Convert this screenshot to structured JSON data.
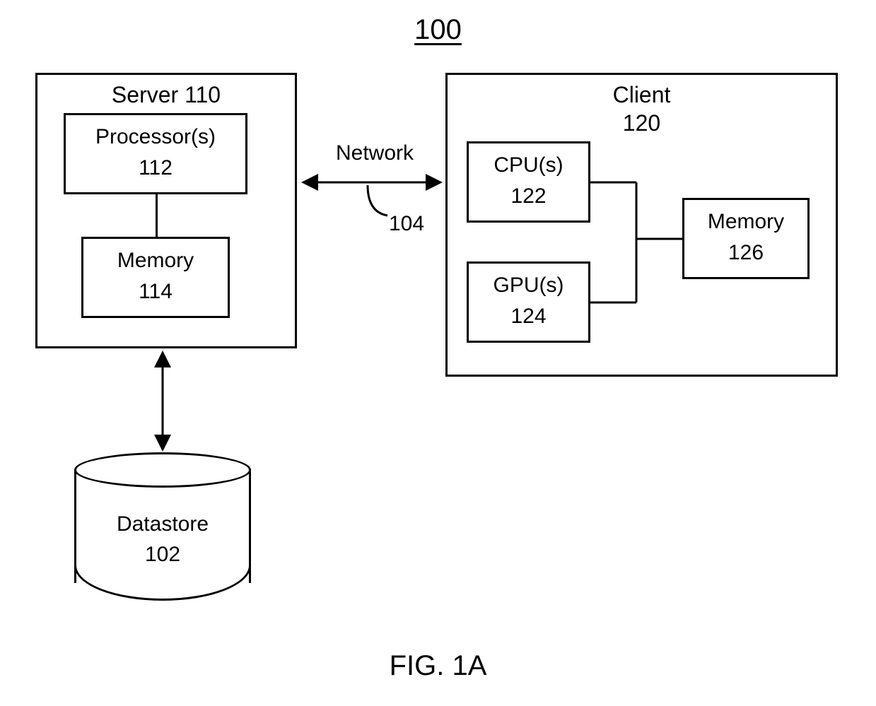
{
  "figure": {
    "number": "100",
    "caption": "FIG. 1A"
  },
  "server": {
    "title": "Server 110",
    "processor": {
      "line1": "Processor(s)",
      "line2": "112"
    },
    "memory": {
      "line1": "Memory",
      "line2": "114"
    }
  },
  "client": {
    "title_line1": "Client",
    "title_line2": "120",
    "cpu": {
      "line1": "CPU(s)",
      "line2": "122"
    },
    "gpu": {
      "line1": "GPU(s)",
      "line2": "124"
    },
    "memory": {
      "line1": "Memory",
      "line2": "126"
    }
  },
  "network": {
    "label": "Network",
    "ref": "104"
  },
  "datastore": {
    "line1": "Datastore",
    "line2": "102"
  }
}
